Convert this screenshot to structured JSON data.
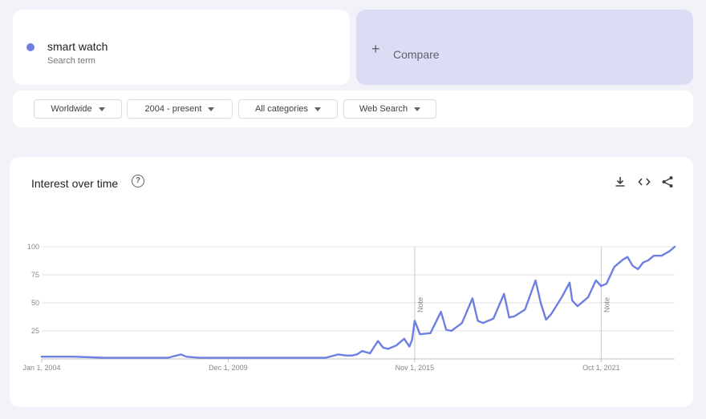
{
  "search_term": {
    "label": "smart watch",
    "sublabel": "Search term",
    "dot_color": "#6e7fe2"
  },
  "compare": {
    "plus": "+",
    "label": "Compare",
    "bg_color": "#dcdcf4"
  },
  "filters": [
    {
      "label": "Worldwide"
    },
    {
      "label": "2004 - present"
    },
    {
      "label": "All categories"
    },
    {
      "label": "Web Search"
    }
  ],
  "panel": {
    "title": "Interest over time",
    "help_icon": "help-circle-icon",
    "toolbar_icons": [
      "download-icon",
      "embed-icon",
      "share-icon"
    ]
  },
  "chart_data": {
    "type": "line",
    "title": "Interest over time",
    "ylim": [
      0,
      100
    ],
    "yticks": [
      25,
      50,
      75,
      100
    ],
    "grid": true,
    "line_color": "#6e7fe2",
    "x_tick_labels": [
      "Jan 1, 2004",
      "Dec 1, 2009",
      "Nov 1, 2015",
      "Oct 1, 2021"
    ],
    "notes": [
      {
        "date": "2015-11",
        "label": "Note"
      },
      {
        "date": "2021-10",
        "label": "Note"
      }
    ],
    "series": [
      {
        "x": [
          "2004-01",
          "2005-01",
          "2006-01",
          "2007-01",
          "2008-01",
          "2008-06",
          "2008-08",
          "2009-01",
          "2010-01",
          "2011-01",
          "2012-01",
          "2012-06",
          "2013-01",
          "2013-06",
          "2013-09",
          "2013-11",
          "2014-01",
          "2014-03",
          "2014-06",
          "2014-09",
          "2014-11",
          "2015-01",
          "2015-04",
          "2015-07",
          "2015-09",
          "2015-10",
          "2015-11",
          "2016-01",
          "2016-05",
          "2016-09",
          "2016-11",
          "2017-01",
          "2017-05",
          "2017-09",
          "2017-11",
          "2018-01",
          "2018-05",
          "2018-09",
          "2018-11",
          "2019-01",
          "2019-05",
          "2019-09",
          "2019-11",
          "2020-01",
          "2020-03",
          "2020-07",
          "2020-10",
          "2020-11",
          "2021-01",
          "2021-05",
          "2021-08",
          "2021-10",
          "2021-12",
          "2022-03",
          "2022-06",
          "2022-08",
          "2022-10",
          "2022-12",
          "2023-02",
          "2023-04",
          "2023-06",
          "2023-09",
          "2023-12",
          "2024-02"
        ],
        "y": [
          2,
          2,
          1,
          1,
          1,
          4,
          2,
          1,
          1,
          1,
          1,
          1,
          1,
          4,
          3,
          3,
          4,
          7,
          5,
          16,
          10,
          9,
          12,
          18,
          11,
          17,
          34,
          22,
          23,
          42,
          26,
          25,
          32,
          54,
          34,
          32,
          36,
          58,
          37,
          38,
          44,
          70,
          50,
          35,
          40,
          55,
          68,
          52,
          47,
          55,
          70,
          65,
          67,
          82,
          88,
          91,
          83,
          80,
          86,
          88,
          92,
          92,
          96,
          100
        ]
      }
    ]
  }
}
